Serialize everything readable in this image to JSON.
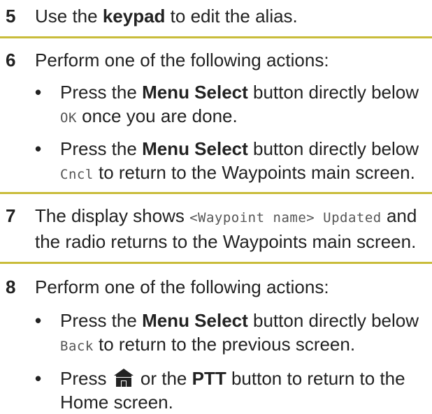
{
  "accent_color": "#c9bc3a",
  "steps": [
    {
      "number": "5",
      "text_prefix": "Use the ",
      "text_bold": "keypad",
      "text_suffix": " to edit the alias."
    },
    {
      "number": "6",
      "text": "Perform one of the following actions:",
      "bullets": [
        {
          "prefix": "Press the ",
          "bold": "Menu Select",
          "middle": " button directly below ",
          "code": "OK",
          "suffix": " once you are done."
        },
        {
          "prefix": "Press the ",
          "bold": "Menu Select",
          "middle": " button directly below ",
          "code": "Cncl",
          "suffix": " to return to the Waypoints main screen."
        }
      ]
    },
    {
      "number": "7",
      "text_prefix": "The display shows ",
      "code": "<Waypoint name> Updated",
      "text_suffix": " and the radio returns to the Waypoints main screen."
    },
    {
      "number": "8",
      "text": "Perform one of the following actions:",
      "bullets": [
        {
          "prefix": "Press the ",
          "bold": "Menu Select",
          "middle": " button directly below ",
          "code": "Back",
          "suffix": " to return to the previous screen."
        },
        {
          "prefix": "Press ",
          "icon": "home-icon",
          "middle": " or the ",
          "bold": "PTT",
          "suffix": " button to return to the Home screen."
        }
      ]
    }
  ]
}
